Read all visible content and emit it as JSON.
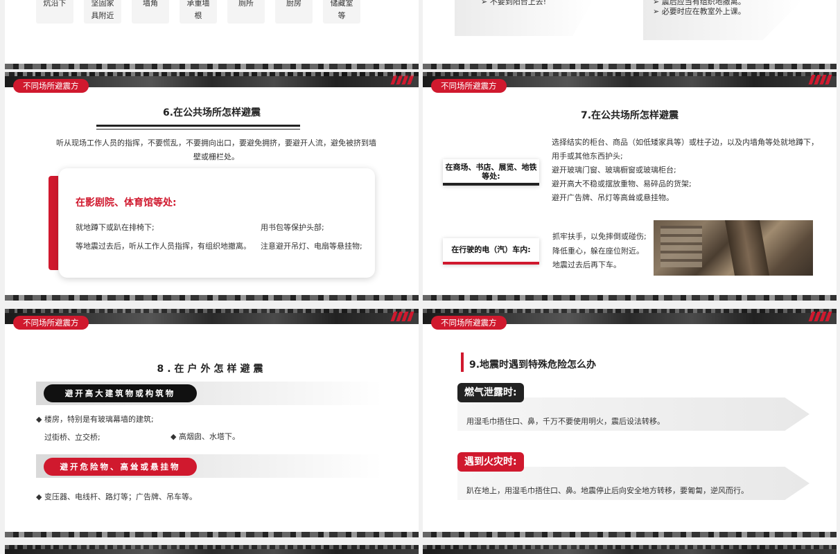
{
  "top_left": {
    "cells": [
      "炕沿下",
      "坚固家\n具附近",
      "墙角",
      "承重墙\n根",
      "厕所",
      "厨房",
      "储藏室\n等"
    ]
  },
  "top_right": {
    "left_text": "➢ 不要到阳台上去!",
    "right_lines": [
      "➢ 震后应当有组织地撤离。",
      "➢ 必要时应在教室外上课。"
    ]
  },
  "section_tag": "不同场所避震方",
  "slide6": {
    "title": "6.在公共场所怎样避震",
    "intro": "听从现场工作人员的指挥，不要慌乱，不要拥向出口，要避免拥挤，要避开人流，避免被挤到墙壁或栅栏处。",
    "card_heading": "在影剧院、体育馆等处:",
    "left_items": [
      "就地蹲下或趴在排椅下;",
      "等地震过去后，听从工作人员指挥，有组织地撤离。"
    ],
    "right_items": [
      "用书包等保护头部;",
      "注意避开吊灯、电扇等悬挂物;"
    ]
  },
  "slide7": {
    "title": "7.在公共场所怎样避震",
    "label1": "在商场、书店、展览、地铁等处:",
    "text1": [
      "选择结实的柜台、商品（如低矮家具等）或柱子边，以及内墙角等处就地蹲下，",
      "用手或其他东西护头;",
      "避开玻璃门窗、玻璃橱窗或玻璃柜台;",
      "避开高大不稳或摆放重物、易碎品的货架;",
      "避开广告牌、吊灯等高耸或悬挂物。"
    ],
    "label2": "在行驶的电（汽）车内:",
    "text2": [
      "抓牢扶手，以免摔倒或碰伤;",
      "降低重心，躲在座位附近。",
      "地震过去后再下车。"
    ]
  },
  "slide8": {
    "title": "8.在户外怎样避震",
    "pill1": "避开高大建筑物或构筑物",
    "line1": "◆ 楼房，特别是有玻璃幕墙的建筑;",
    "line2a": "过街桥、立交桥;",
    "line2b": "◆ 高烟囱、水塔下。",
    "pill2": "避开危险物、高耸或悬挂物",
    "line3": "◆ 变压器、电线杆、路灯等；广告牌、吊车等。"
  },
  "slide9": {
    "title": "9.地震时遇到特殊危险怎么办",
    "label1": "燃气泄露时:",
    "text1": "用湿毛巾捂住口、鼻，千万不要使用明火，震后设法转移。",
    "label2": "遇到火灾时:",
    "text2": "趴在地上，用湿毛巾捂住口、鼻。地震停止后向安全地方转移，要匍匐，逆风而行。"
  },
  "colors": {
    "accent": "#d0192e",
    "dark": "#222222"
  }
}
